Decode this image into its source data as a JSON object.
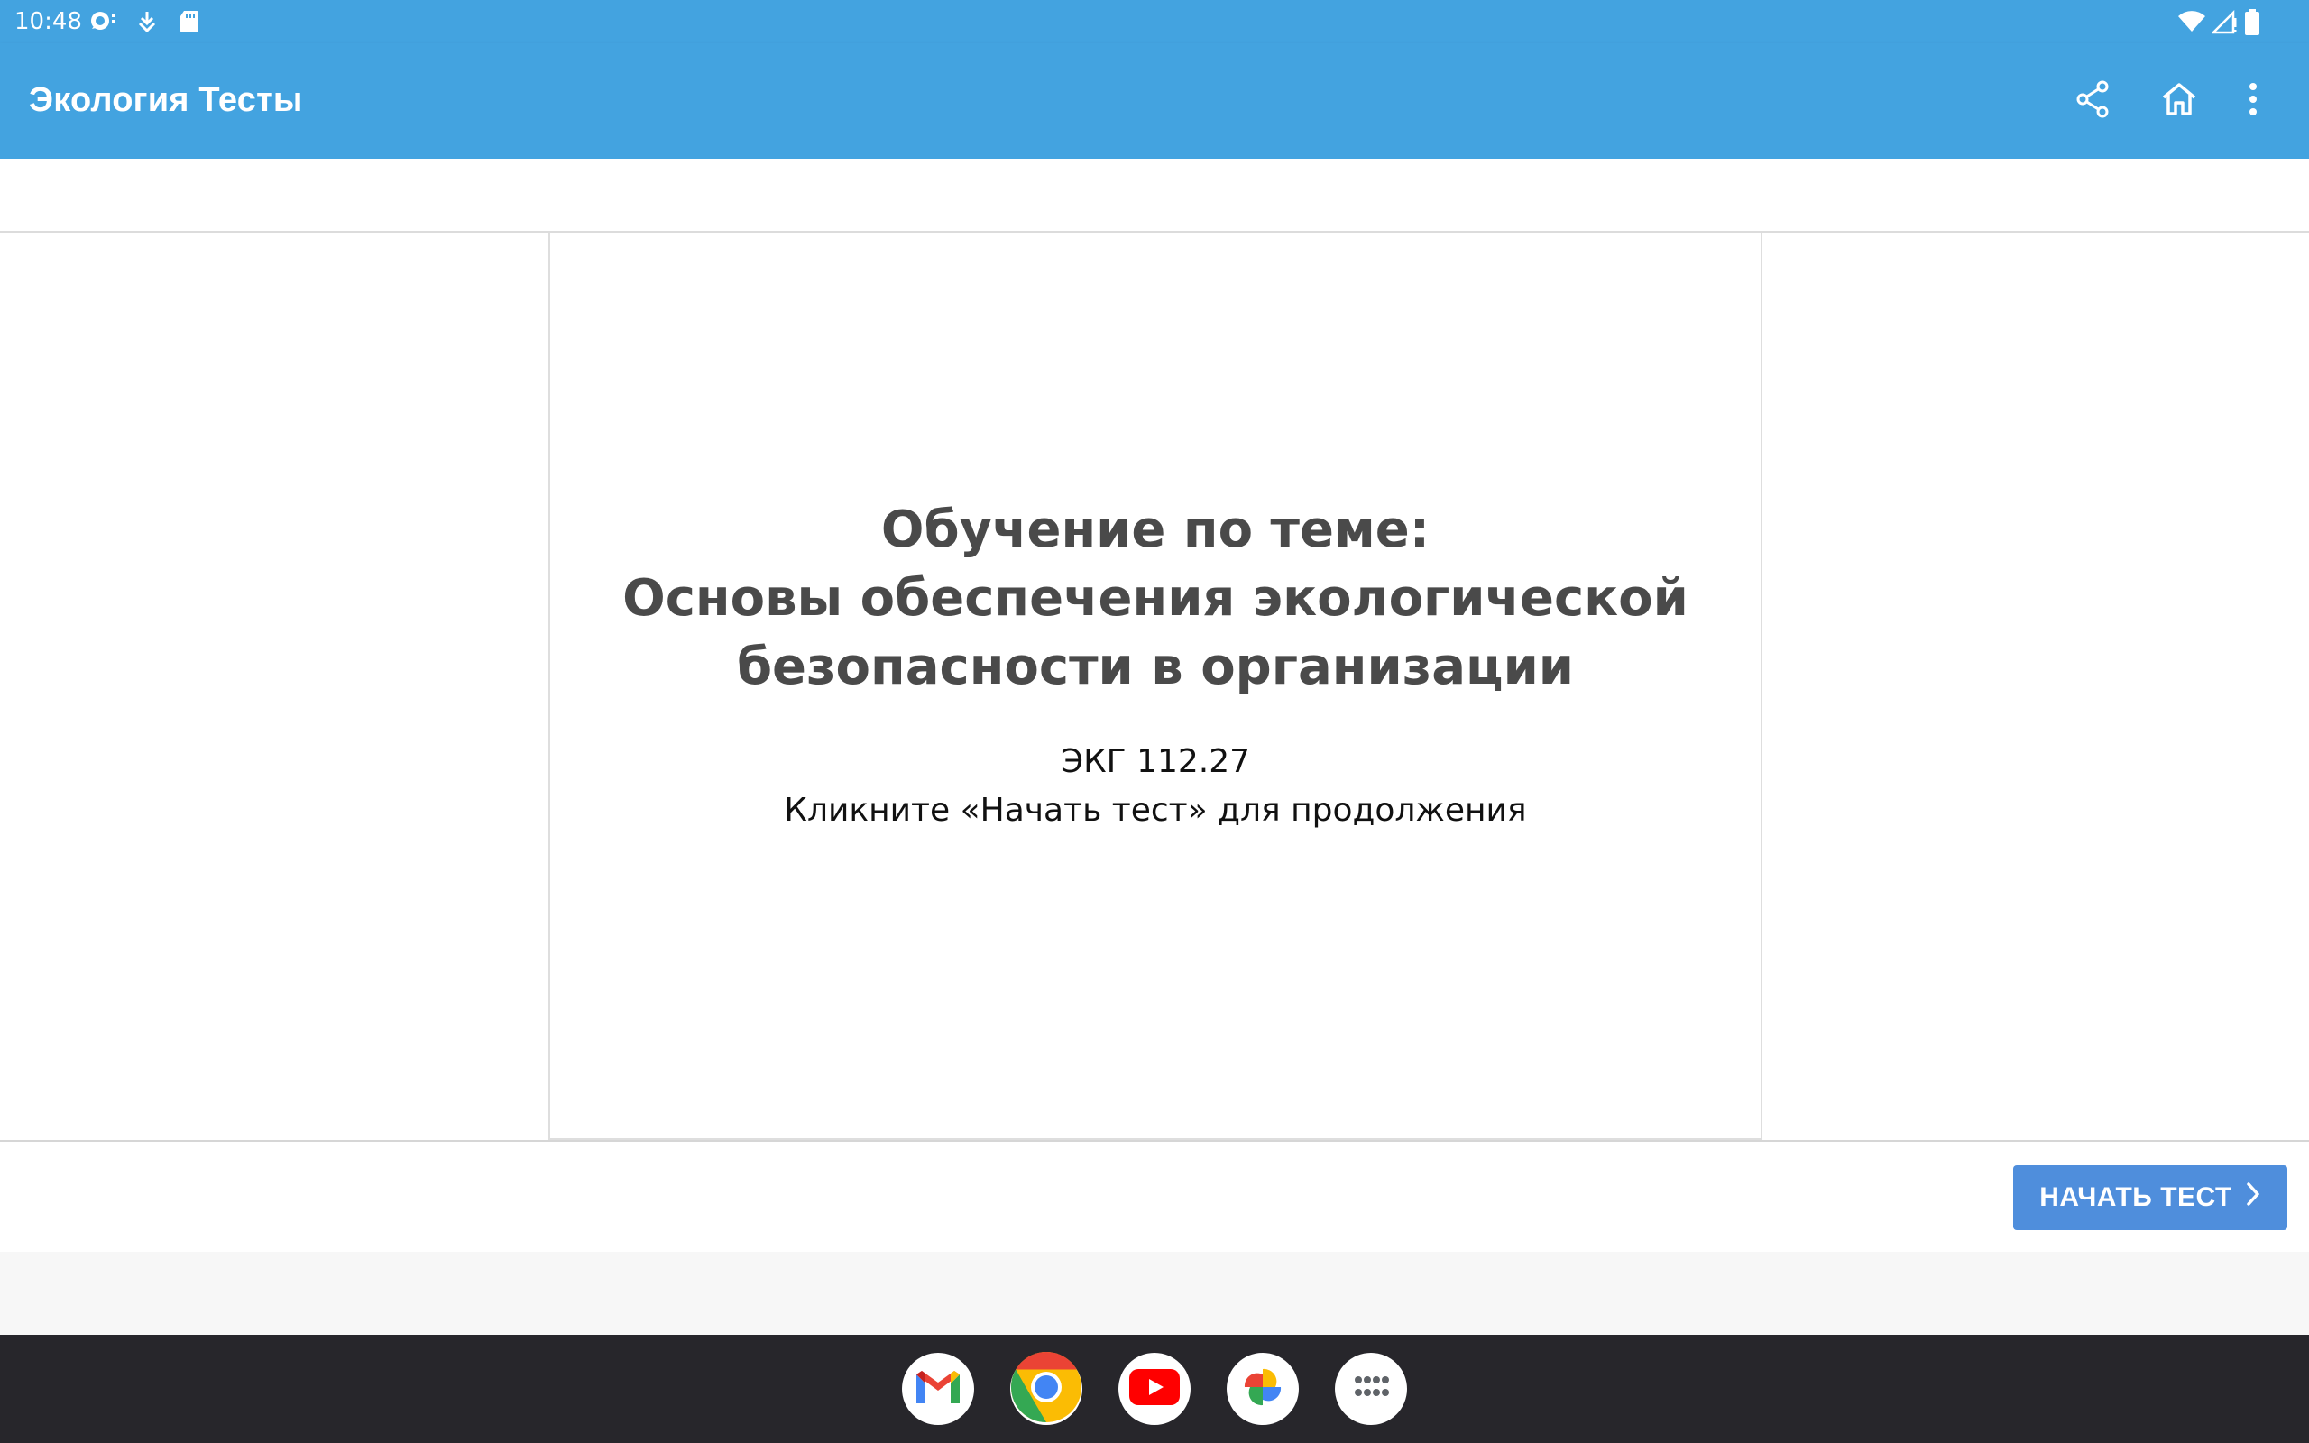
{
  "status_bar": {
    "time": "10:48",
    "left_icons": [
      "chat-notification-icon",
      "download-icon",
      "sd-card-icon"
    ],
    "right_icons": [
      "wifi-icon",
      "cell-signal-icon",
      "battery-icon"
    ]
  },
  "app_bar": {
    "title": "Экология Тесты",
    "actions": [
      "share-icon",
      "home-icon",
      "more-vert-icon"
    ],
    "color": "#43a3e0"
  },
  "slide": {
    "title_lines": [
      "Обучение по теме:",
      "Основы обеспечения экологической",
      "безопасности в организации"
    ],
    "code": "ЭКГ 112.27",
    "hint": "Кликните «Начать тест» для продолжения"
  },
  "footer": {
    "start_button_label": "НАЧАТЬ ТЕСТ",
    "start_button_color": "#4f8edc"
  },
  "dock": {
    "apps": [
      "gmail-icon",
      "chrome-icon",
      "youtube-icon",
      "photos-icon",
      "app-drawer-icon"
    ]
  }
}
